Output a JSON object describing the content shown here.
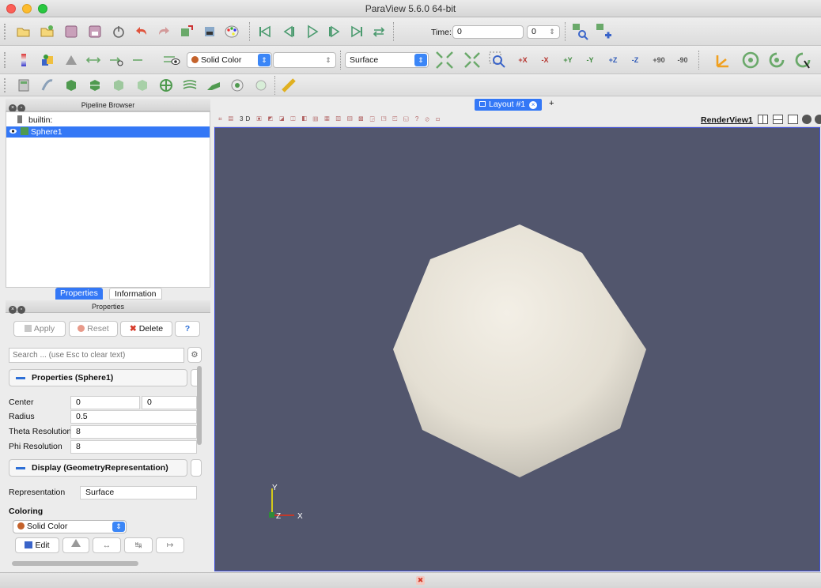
{
  "window": {
    "title": "ParaView 5.6.0 64-bit"
  },
  "main_toolbar": {
    "time_label": "Time:",
    "time_value": "0",
    "timestep_value": "0"
  },
  "display_toolbar": {
    "coloring_value": "Solid Color",
    "component_value": "",
    "representation_value": "Surface",
    "camera_buttons": [
      "+X",
      "-X",
      "+Y",
      "-Y",
      "+Z",
      "-Z",
      "+90",
      "-90"
    ]
  },
  "pipeline_browser": {
    "title": "Pipeline Browser",
    "items": [
      {
        "label": "builtin:",
        "icon": "server-icon"
      },
      {
        "label": "Sphere1",
        "icon": "sphere-source-icon",
        "selected": true
      }
    ]
  },
  "panel_tabs": [
    {
      "label": "Properties",
      "active": true
    },
    {
      "label": "Information",
      "active": false
    }
  ],
  "properties_panel": {
    "title": "Properties",
    "buttons": {
      "apply": "Apply",
      "reset": "Reset",
      "delete": "Delete",
      "help": "?"
    },
    "search_placeholder": "Search ... (use Esc to clear text)",
    "section_properties": "Properties (Sphere1)",
    "fields": {
      "center_label": "Center",
      "center_x": "0",
      "center_y": "0",
      "radius_label": "Radius",
      "radius_value": "0.5",
      "theta_label": "Theta Resolution",
      "theta_value": "8",
      "phi_label": "Phi Resolution",
      "phi_value": "8"
    },
    "section_display": "Display (GeometryRepresentation)",
    "representation_label": "Representation",
    "representation_value": "Surface",
    "coloring_label": "Coloring",
    "coloring_value": "Solid Color",
    "edit_label": "Edit"
  },
  "layout": {
    "tab_label": "Layout #1",
    "add_tab": "+",
    "view_name": "RenderView1",
    "view_toolbar_3d": "3D"
  },
  "render_view": {
    "background": "#52566d",
    "object": "Sphere1",
    "axes": {
      "y": "Y",
      "z": "Z",
      "x": "X"
    }
  },
  "colors": {
    "selection": "#3478f6",
    "render_border": "#3b4bd8",
    "accent": "#3b86f7"
  }
}
